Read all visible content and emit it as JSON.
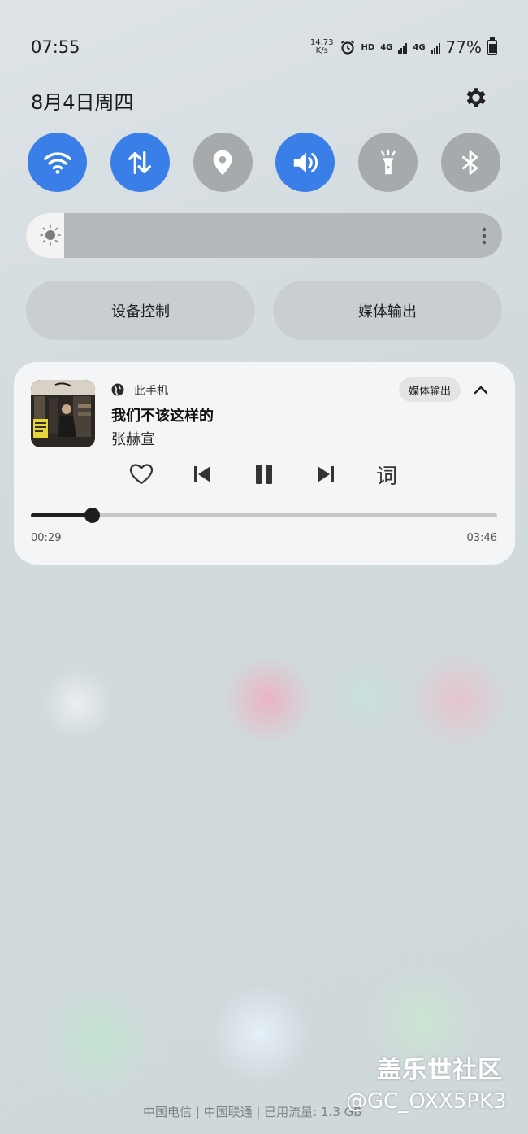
{
  "status_bar": {
    "time": "07:55",
    "net_speed_value": "14.73",
    "net_speed_unit": "K/s",
    "hd": "HD",
    "net1": "4G",
    "net2": "4G",
    "battery": "77%"
  },
  "header": {
    "date": "8月4日周四"
  },
  "quick_settings": [
    {
      "icon": "wifi-icon",
      "state": "on"
    },
    {
      "icon": "mobile-data-icon",
      "state": "on"
    },
    {
      "icon": "location-icon",
      "state": "off"
    },
    {
      "icon": "sound-icon",
      "state": "on"
    },
    {
      "icon": "flashlight-icon",
      "state": "off"
    },
    {
      "icon": "bluetooth-icon",
      "state": "off"
    }
  ],
  "brightness": {
    "level": 0.08
  },
  "buttons": {
    "device_control": "设备控制",
    "media_output": "媒体输出"
  },
  "media": {
    "source": "此手机",
    "output_label": "媒体输出",
    "song": "我们不该这样的",
    "artist": "张赫宣",
    "lyrics_label": "词",
    "elapsed": "00:29",
    "total": "03:46",
    "progress": 0.13
  },
  "footer": {
    "carrier_info": "中国电信 | 中国联通 | 已用流量: 1.3 GB",
    "watermark_line1": "盖乐世社区",
    "watermark_line2": "@GC_OXX5PK3"
  },
  "colors": {
    "accent": "#3a7ee8",
    "tile_off": "#a6aaad",
    "card_bg": "#f4f5f6"
  }
}
